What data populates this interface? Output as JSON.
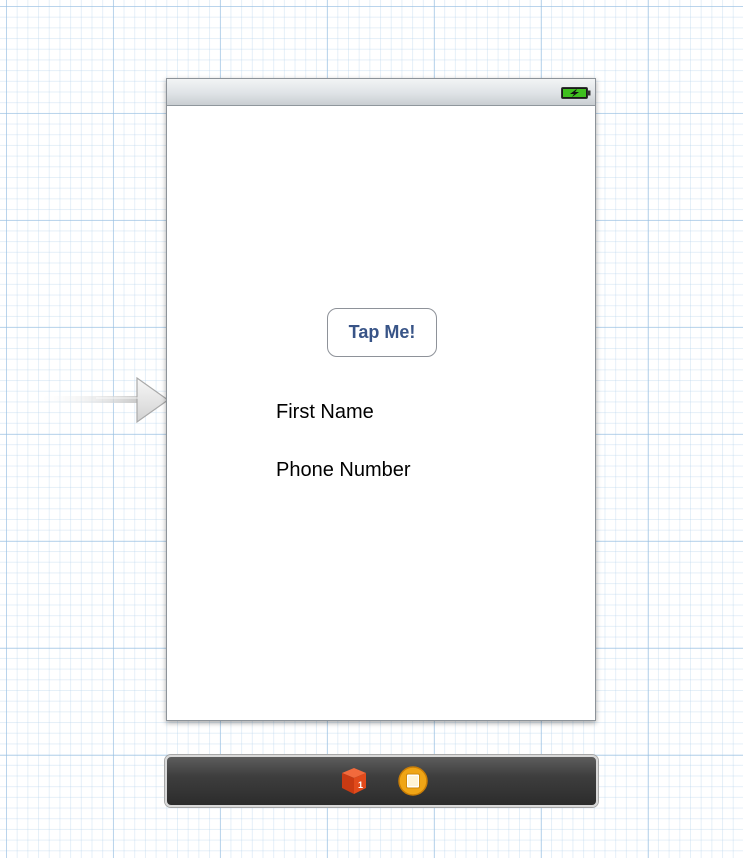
{
  "canvas": {
    "background": "#ffffff",
    "grid_color": "#bcd4ea"
  },
  "entry_point": {
    "icon": "storyboard-entry-arrow-icon"
  },
  "scene": {
    "status_bar": {
      "battery_icon": "battery-charging-icon",
      "battery_color": "#3fbf1f"
    },
    "button": {
      "label": "Tap Me!",
      "color": "#385487"
    },
    "labels": [
      {
        "text": "First Name"
      },
      {
        "text": "Phone Number"
      }
    ]
  },
  "dock": {
    "icons": [
      {
        "name": "first-responder-cube-icon",
        "color": "#e14a1b"
      },
      {
        "name": "view-controller-icon",
        "color": "#f0a516"
      }
    ]
  }
}
